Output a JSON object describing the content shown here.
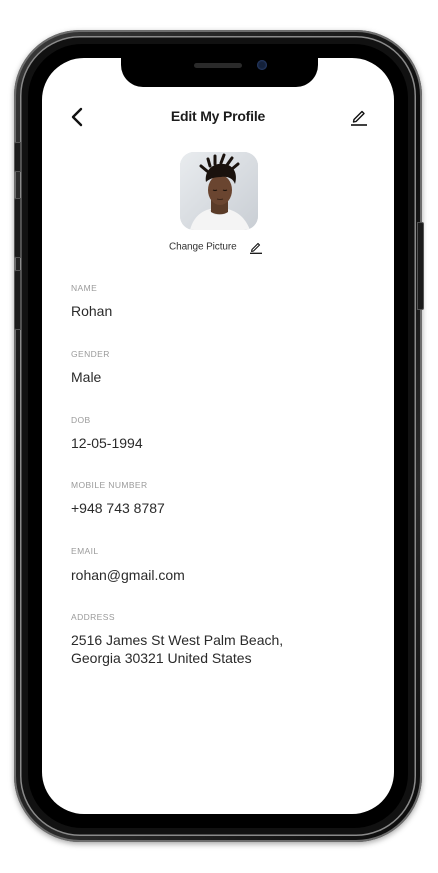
{
  "header": {
    "title": "Edit My Profile"
  },
  "avatar": {
    "change_picture_label": "Change Picture"
  },
  "fields": [
    {
      "label": "NAME",
      "value": "Rohan"
    },
    {
      "label": "GENDER",
      "value": "Male"
    },
    {
      "label": "DOB",
      "value": "12-05-1994"
    },
    {
      "label": "MOBILE NUMBER",
      "value": "+948 743 8787"
    },
    {
      "label": "EMAIL",
      "value": "rohan@gmail.com"
    },
    {
      "label": "ADDRESS",
      "value_line1": "2516 James St West Palm Beach,",
      "value_line2": "Georgia 30321 United States"
    }
  ],
  "icons": {
    "back": "chevron-left-icon",
    "edit": "pencil-icon"
  },
  "colors": {
    "text_primary": "#1c1c1c",
    "label_gray": "#9a9a9a",
    "background": "#ffffff"
  }
}
